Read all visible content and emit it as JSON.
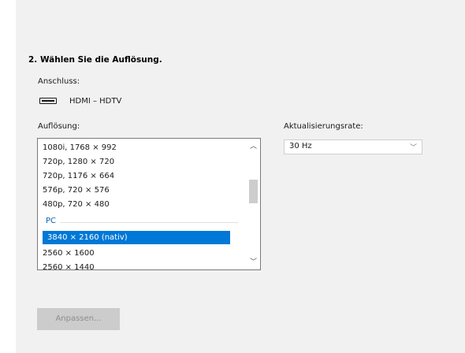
{
  "heading": "2. Wählen Sie die Auflösung.",
  "connection": {
    "label": "Anschluss:",
    "value": "HDMI – HDTV",
    "icon": "tv-icon"
  },
  "resolution": {
    "label": "Auflösung:",
    "items_above": [
      "1080i, 1768 × 992",
      "720p, 1280 × 720",
      "720p, 1176 × 664",
      "576p, 720 × 576",
      "480p, 720 × 480"
    ],
    "group_header": "PC",
    "selected": "3840 × 2160 (nativ)",
    "items_below": [
      "2560 × 1600",
      "2560 × 1440"
    ]
  },
  "refresh_rate": {
    "label": "Aktualisierungsrate:",
    "value": "30 Hz"
  },
  "customize_button": "Anpassen...",
  "colors": {
    "selection": "#0078d7",
    "group_header": "#0b62b6"
  }
}
